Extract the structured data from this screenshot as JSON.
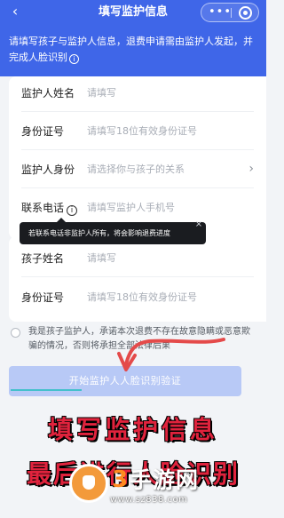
{
  "nav": {
    "back_icon": "chevron-left-icon",
    "title": "填写监护信息",
    "more_icon": "•••",
    "target_icon": "record-icon"
  },
  "notice": {
    "text": "请填写孩子与监护人信息，退费申请需由监护人发起，并完成人脸识别",
    "icon": "i"
  },
  "guardian_form": {
    "rows": [
      {
        "label": "监护人姓名",
        "value": "请填写"
      },
      {
        "label": "身份证号",
        "value": "请填写18位有效身份证号"
      },
      {
        "label": "监护人身份",
        "value": "请选择你与孩子的关系",
        "chevron": "›"
      },
      {
        "label": "联系电话",
        "value": "请填写监护人手机号",
        "icon": "i"
      }
    ]
  },
  "tooltip": {
    "text": "若联系电话非监护人所有，将会影响退费进度",
    "close": "×"
  },
  "child_form": {
    "rows": [
      {
        "label": "孩子姓名",
        "value": "请填写"
      },
      {
        "label": "身份证号",
        "value": "请填写18位有效身份证号"
      }
    ]
  },
  "agreement": {
    "text": "我是孩子监护人，承诺本次退费不存在故意隐瞒或恶意欺骗的情况，否则将承担全部法律后果"
  },
  "submit": {
    "label": "开始监护人人脸识别验证"
  },
  "overlay": {
    "caption_line1": "填写监护信息",
    "caption_line2": "最后进行人脸识别",
    "watermark_num": "3",
    "watermark_name": "手游网",
    "watermark_url": "www.sz838.com",
    "caption_color": "#e0233d",
    "accent_color": "#3f66e8"
  }
}
